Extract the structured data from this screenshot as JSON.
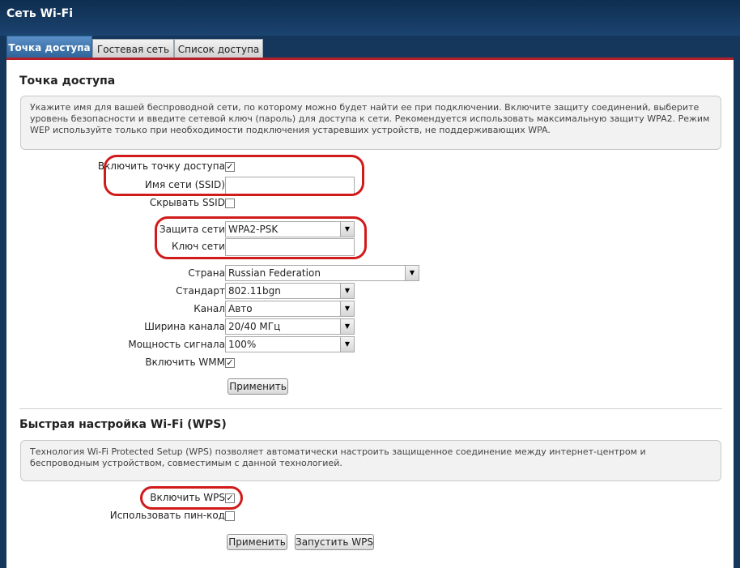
{
  "header": {
    "title": "Сеть Wi-Fi"
  },
  "tabs": [
    {
      "label": "Точка доступа",
      "active": true
    },
    {
      "label": "Гостевая сеть",
      "active": false
    },
    {
      "label": "Список доступа",
      "active": false
    }
  ],
  "access_point": {
    "title": "Точка доступа",
    "info": "Укажите имя для вашей беспроводной сети, по которому можно будет найти ее при подключении. Включите защиту соединений, выберите уровень безопасности и введите сетевой ключ (пароль) для доступа к сети. Рекомендуется использовать максимальную защиту WPA2. Режим WEP используйте только при необходимости подключения устаревших устройств, не поддерживающих WPA.",
    "enable_label": "Включить точку доступа:",
    "enable_checked": true,
    "ssid_label": "Имя сети (SSID):",
    "ssid_value": "",
    "hide_ssid_label": "Скрывать SSID:",
    "hide_ssid_checked": false,
    "security_label": "Защита сети:",
    "security_value": "WPA2-PSK",
    "key_label": "Ключ сети:",
    "key_value": "",
    "country_label": "Страна:",
    "country_value": "Russian Federation",
    "standard_label": "Стандарт:",
    "standard_value": "802.11bgn",
    "channel_label": "Канал:",
    "channel_value": "Авто",
    "width_label": "Ширина канала:",
    "width_value": "20/40 МГц",
    "power_label": "Мощность сигнала:",
    "power_value": "100%",
    "wmm_label": "Включить WMM:",
    "wmm_checked": true,
    "apply_label": "Применить"
  },
  "wps": {
    "title": "Быстрая настройка Wi-Fi (WPS)",
    "info": "Технология Wi-Fi Protected Setup (WPS) позволяет автоматически настроить защищенное соединение между интернет-центром и беспроводным устройством, совместимым с данной технологией.",
    "enable_label": "Включить WPS:",
    "enable_checked": true,
    "pin_label": "Использовать пин-код:",
    "pin_checked": false,
    "apply_label": "Применить",
    "start_label": "Запустить WPS"
  },
  "colors": {
    "header_bg": "#16375c",
    "tab_active": "#3a70a8",
    "panel_accent": "#b3202a",
    "highlight": "#d11a1a"
  }
}
